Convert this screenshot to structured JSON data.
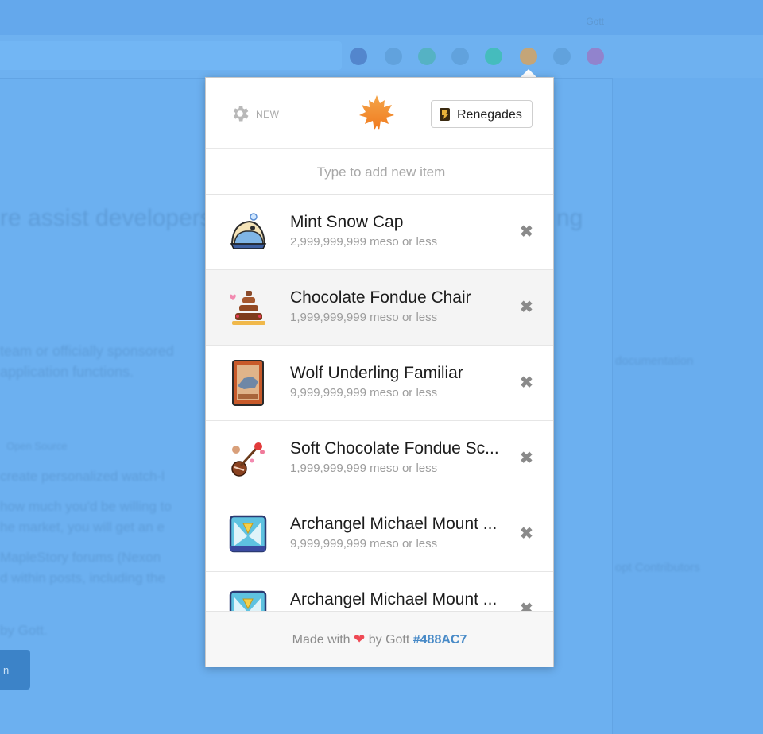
{
  "background": {
    "user_name": "Gott",
    "blurred_lines": [
      "re assist developers",
      "ng",
      "team or officially sponsored",
      "application functions.",
      "Open Source",
      "create personalized watch-l",
      "how much you'd be willing to",
      "he market, you will get an e",
      "MapleStory forums (Nexon",
      "d within posts, including the",
      "by Gott.",
      "documentation",
      "opt Contributors"
    ],
    "button_label": "n"
  },
  "popup": {
    "settings_label": "NEW",
    "world_name": "Renegades",
    "search_placeholder": "Type to add new item",
    "items": [
      {
        "name": "Mint Snow Cap",
        "price": "2,999,999,999 meso or less",
        "icon": "mint-snow-cap-icon"
      },
      {
        "name": "Chocolate Fondue Chair",
        "price": "1,999,999,999 meso or less",
        "icon": "chocolate-fondue-chair-icon"
      },
      {
        "name": "Wolf Underling Familiar",
        "price": "9,999,999,999 meso or less",
        "icon": "wolf-familiar-card-icon"
      },
      {
        "name": "Soft Chocolate Fondue Sc...",
        "price": "1,999,999,999 meso or less",
        "icon": "chocolate-fondue-scepter-icon"
      },
      {
        "name": "Archangel Michael Mount ...",
        "price": "9,999,999,999 meso or less",
        "icon": "archangel-mount-icon"
      },
      {
        "name": "Archangel Michael Mount ...",
        "price": "",
        "icon": "archangel-mount-icon"
      }
    ],
    "remove_glyph": "✖",
    "footer": {
      "made_with": "Made with",
      "heart": "❤",
      "by": "by Gott",
      "hex": "#488AC7"
    }
  },
  "colors": {
    "accent": "#488AC7",
    "heart": "#ef4a55",
    "overlay": "#6cb0f0"
  }
}
